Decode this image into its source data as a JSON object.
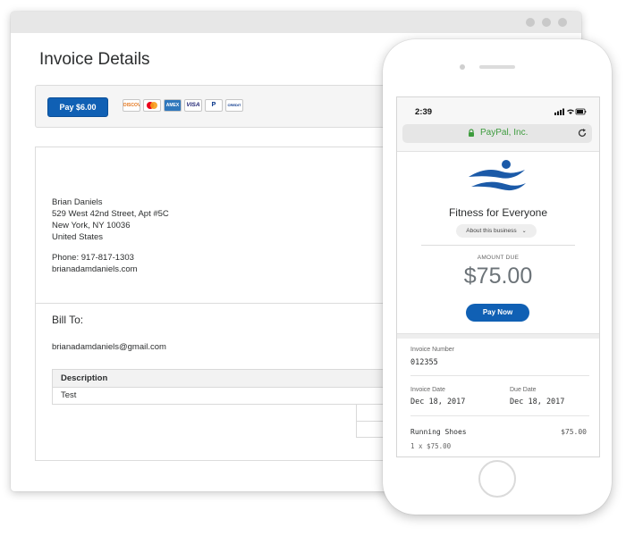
{
  "desktop": {
    "title": "Invoice Details",
    "pay_button": "Pay $6.00",
    "card_icons": [
      "discover-icon",
      "mastercard-icon",
      "amex-icon",
      "visa-icon",
      "paypal-icon",
      "paypal-credit-icon"
    ],
    "card_labels": [
      "DISCOVER",
      "MC",
      "AMEX",
      "VISA",
      "P",
      "CREDIT"
    ],
    "sender": {
      "name": "Brian Daniels",
      "street": "529 West 42nd Street, Apt #5C",
      "city": "New York, NY 10036",
      "country": "United States",
      "phone": "Phone: 917-817-1303",
      "email": "brianadamdaniels.com"
    },
    "bill_to_label": "Bill To:",
    "bill_to_email": "brianadamdaniels@gmail.com",
    "table": {
      "header": "Description",
      "rows": [
        "Test"
      ]
    }
  },
  "phone": {
    "time": "2:39",
    "url": "PayPal, Inc.",
    "business_name": "Fitness for Everyone",
    "about_label": "About this business",
    "amount_due_label": "AMOUNT DUE",
    "amount_due": "$75.00",
    "pay_now": "Pay Now",
    "invoice_number_label": "Invoice Number",
    "invoice_number": "012355",
    "invoice_date_label": "Invoice Date",
    "invoice_date": "Dec 18, 2017",
    "due_date_label": "Due Date",
    "due_date": "Dec 18, 2017",
    "item": {
      "name": "Running Shoes",
      "price": "$75.00",
      "qty": "1 x $75.00"
    }
  },
  "colors": {
    "paypal_blue": "#1060b4",
    "lock_green": "#3e9c3e",
    "logo_blue": "#1b5aa8"
  }
}
